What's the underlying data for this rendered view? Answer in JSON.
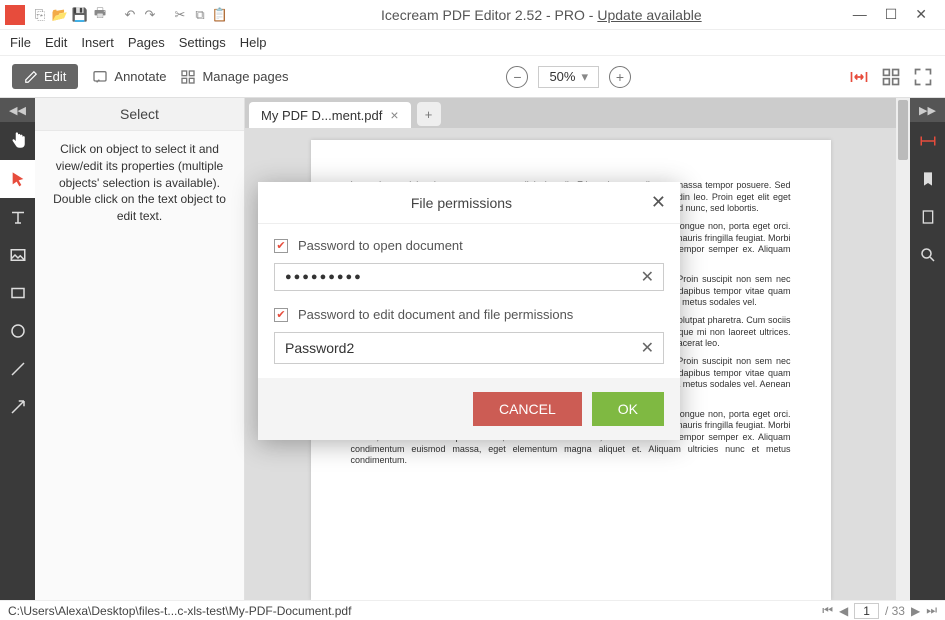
{
  "titlebar": {
    "app_name": "Icecream PDF Editor 2.52 - PRO - ",
    "update_link": "Update available"
  },
  "menu": {
    "items": [
      "File",
      "Edit",
      "Insert",
      "Pages",
      "Settings",
      "Help"
    ]
  },
  "toolbar": {
    "edit": "Edit",
    "annotate": "Annotate",
    "manage": "Manage pages",
    "zoom": "50%"
  },
  "select_panel": {
    "title": "Select",
    "text": "Click on object to select it and view/edit its properties (multiple objects' selection is available). Double click on the text object to edit text."
  },
  "tab": {
    "label": "My PDF D...ment.pdf"
  },
  "dialog": {
    "title": "File permissions",
    "chk_open": "Password to open document",
    "chk_edit": "Password to edit document and file permissions",
    "pwd1_mask": "●●●●●●●●●",
    "pwd2_value": "Password2",
    "cancel": "CANCEL",
    "ok": "OK"
  },
  "status": {
    "path": "C:\\Users\\Alexa\\Desktop\\files-t...c-xls-test\\My-PDF-Document.pdf",
    "page": "1",
    "total": "/ 33"
  },
  "doc_text": {
    "p1": "Lorem ipsum dolor sit amet, consectetur adipiscing elit. Etiam sit amet tellus eu massa tempor posuere. Sed consectetur nunc nec blandit tempor. Ut id sollicitudin diam eget, mollis sollicitudin leo. Proin eget elit eget mauris fringilla feugiat. Morbi rutrum, mi hendrerit tristique ultricies, dui nisl euismod nunc, sed lobortis.",
    "p2": "Cras tempor libero in fermentum convallis. Duis orci sapien, venenatis sit amet congue non, porta eget orci. Praesent velit nisl, dictum non nisl non, mollis sollicitudin leo. Proin eget elit eget mauris fringilla feugiat. Morbi rutrum, mi hendrerit tristique ultricies, dui nisl euismod nunc, sed lobortis sed tempor semper ex. Aliquam euismod massa, eget elementum magna aliquet et.",
    "p3": "Aliquam vel enim elit. Ut ultrices lorem metus, a mattis quam luctus tincidunt. Proin suscipit non sem nec semper. Duis lacus elit, gravida vitae est at, faucibus sodales metus. Curabitur dapibus tempor vitae quam condimentum, id dignissim diam faucibus. Aenean pharetra nibh felis, nec pharetra metus sodales vel.",
    "p4": "Sed dictum nu at libero lorem. Pellentesque eu magna lorem. Sed aliquet nisi ut volutpat pharetra. Cum sociis natoque et magnis dis parturient montes, nascetur ridiculus mus. Fusce scelerisque mi non laoreet ultrices. Morbi tempor arcu id quam bibendum, eu porta turpis venenatis. Nulla at massa placerat leo.",
    "p5": "Aliquam vel enim elit. Ut ultrices lorem metus, a mattis quam luctus tincidunt. Proin suscipit non sem nec semper. Duis lacus elit, gravida vitae est at, faucibus sodales metus. Curabitur dapibus tempor vitae quam condimentum, id dignissim diam faucibus. Aenean pharetra nibh felis, nec pharetra metus sodales vel. Aenean et interdum ante, vel scelerisque quam.",
    "p6": "Cras tempor libero in fermentum convallis. Duis orci sapien, venenatis sit amet congue non, porta eget orci. Praesent velit nisl, dictum non nisl non, mollis sollicitudin leo. Proin eget elit eget mauris fringilla feugiat. Morbi rutrum, mi hendrerit tristique ultricies, dui nisl euismod nunc, sed lobortis sed tempor semper ex. Aliquam condimentum euismod massa, eget elementum magna aliquet et. Aliquam ultricies nunc et metus condimentum."
  }
}
